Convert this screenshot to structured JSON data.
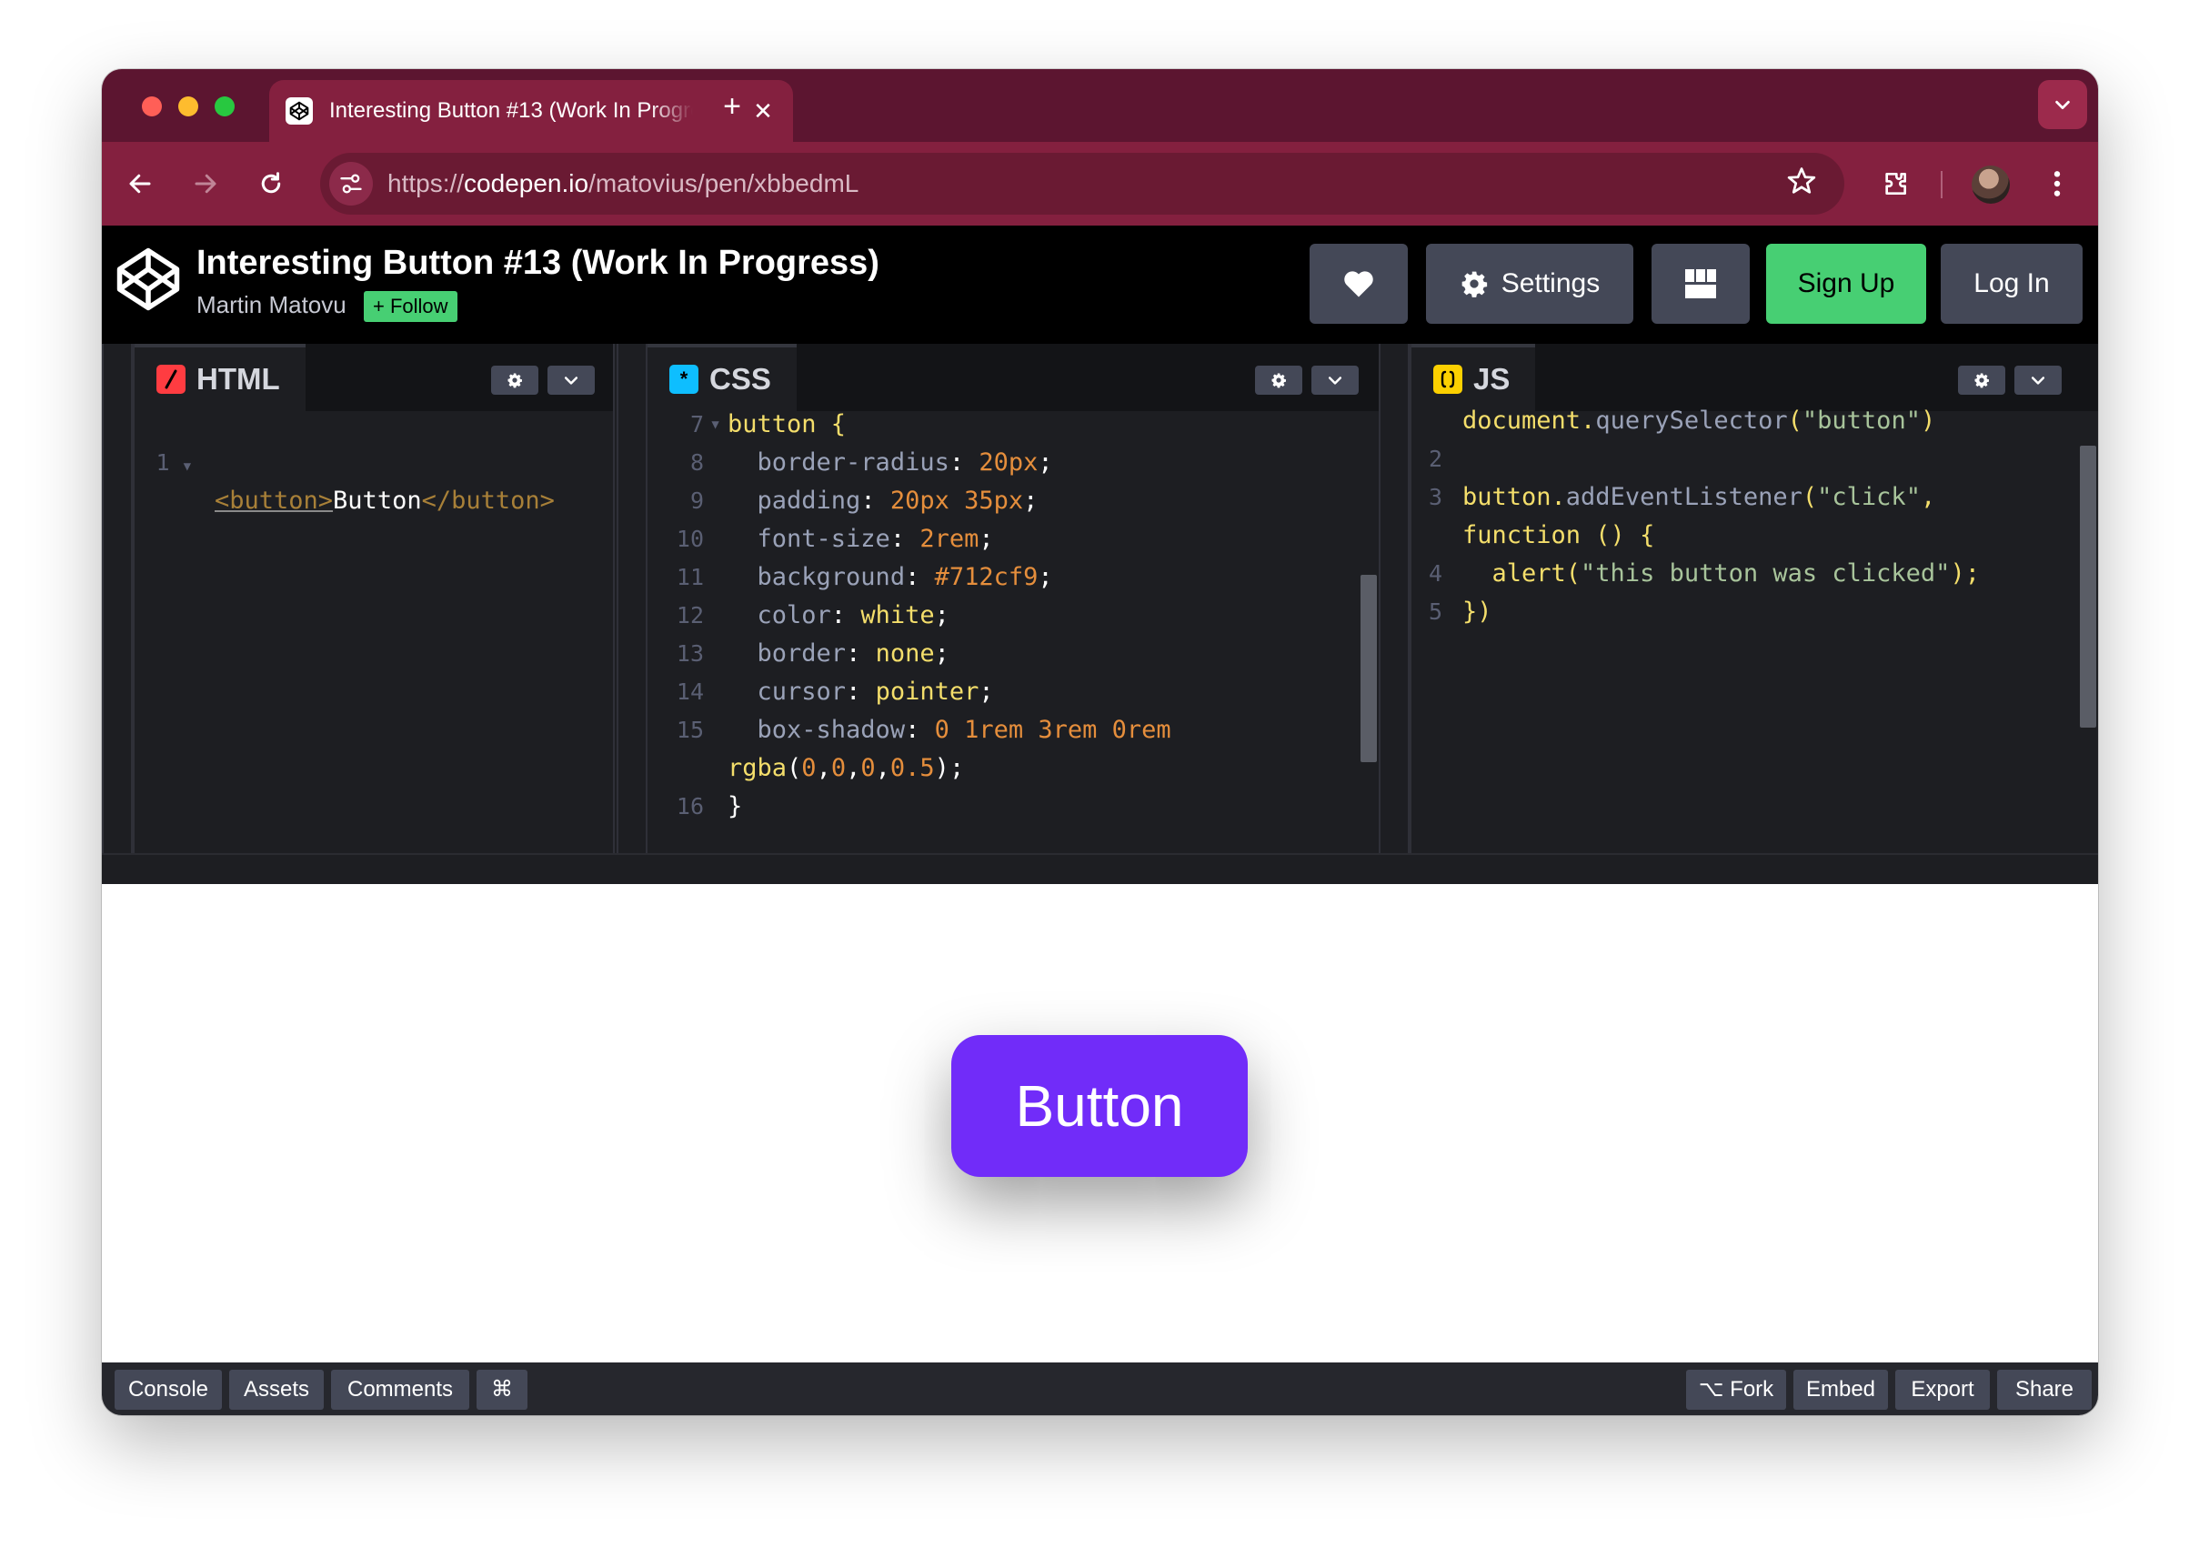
{
  "browser": {
    "tab_title": "Interesting Button #13 (Work In Progress)",
    "url_scheme": "https://",
    "url_host": "codepen.io",
    "url_path": "/matovius/pen/xbbedmL"
  },
  "header": {
    "pen_title": "Interesting Button #13 (Work In Progress)",
    "author": "Martin Matovu",
    "follow_label": "+ Follow",
    "settings_label": "Settings",
    "signup_label": "Sign Up",
    "login_label": "Log In"
  },
  "editors": {
    "html": {
      "name": "HTML",
      "badge_color": "#ff3c41",
      "lines": [
        {
          "n": "1",
          "open": "<button>",
          "text": "Button",
          "close": "</button>"
        }
      ]
    },
    "css": {
      "name": "CSS",
      "badge_color": "#0ebeff",
      "lines": [
        {
          "n": "7",
          "indent": "",
          "prop": "",
          "value": "",
          "raw": "button {"
        },
        {
          "n": "8",
          "indent": "  ",
          "prop": "border-radius",
          "value": "20px"
        },
        {
          "n": "9",
          "indent": "  ",
          "prop": "padding",
          "value": "20px 35px"
        },
        {
          "n": "10",
          "indent": "  ",
          "prop": "font-size",
          "value": "2rem"
        },
        {
          "n": "11",
          "indent": "  ",
          "prop": "background",
          "value": "#712cf9"
        },
        {
          "n": "12",
          "indent": "  ",
          "prop": "color",
          "value": "white"
        },
        {
          "n": "13",
          "indent": "  ",
          "prop": "border",
          "value": "none"
        },
        {
          "n": "14",
          "indent": "  ",
          "prop": "cursor",
          "value": "pointer"
        },
        {
          "n": "15",
          "indent": "  ",
          "prop": "box-shadow",
          "value": "0 1rem 3rem 0rem"
        },
        {
          "n": "",
          "indent": "",
          "prop": "",
          "value": "",
          "raw": "rgba(0,0,0,0.5);"
        },
        {
          "n": "16",
          "indent": "",
          "prop": "",
          "value": "",
          "raw": "}"
        }
      ]
    },
    "js": {
      "name": "JS",
      "badge_color": "#fcd000",
      "lines": [
        {
          "n": "",
          "raw": "document.querySelector(\"button\")"
        },
        {
          "n": "2",
          "raw": ""
        },
        {
          "n": "3",
          "raw": "button.addEventListener(\"click\","
        },
        {
          "n": "",
          "raw": "function () {"
        },
        {
          "n": "4",
          "raw": "  alert(\"this button was clicked\");"
        },
        {
          "n": "5",
          "raw": "})"
        }
      ]
    }
  },
  "preview": {
    "button_label": "Button",
    "button_color": "#712cf9"
  },
  "footer": {
    "left": [
      "Console",
      "Assets",
      "Comments",
      "⌘"
    ],
    "fork_label": "Fork",
    "embed_label": "Embed",
    "export_label": "Export",
    "share_label": "Share"
  },
  "colors": {
    "browser_frame": "#84203f",
    "tabstrip": "#5c1530",
    "codepen_green": "#47cf73",
    "editor_bg": "#1d1e22"
  }
}
